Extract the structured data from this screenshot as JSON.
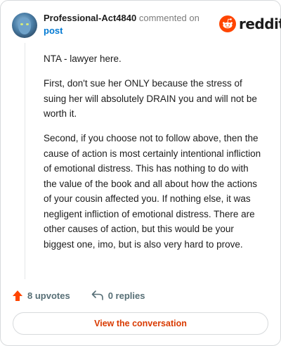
{
  "comment": {
    "username": "Professional-Act4840",
    "action_text": "commented on",
    "post_link_label": "post",
    "paragraphs": [
      "NTA - lawyer here.",
      "First, don't sue her ONLY because the stress of suing her will absolutely DRAIN you and will not be worth it.",
      "Second, if you choose not to follow above, then the cause of action is most certainly intentional infliction of emotional distress. This has nothing to do with the value of the book and all about how the actions of your cousin affected you. If nothing else, it was negligent infliction of emotional distress. There are other causes of action, but this would be your biggest one, imo, but is also very hard to prove."
    ]
  },
  "brand": {
    "name": "reddit",
    "icon": "reddit-snoo-icon",
    "color": "#ff4500"
  },
  "actions": {
    "upvotes_label": "8 upvotes",
    "upvote_icon": "upvote-arrow-icon",
    "upvote_color": "#ff4500",
    "replies_label": "0 replies",
    "reply_icon": "reply-arrow-icon"
  },
  "cta": {
    "label": "View the conversation",
    "color": "#d93a00"
  }
}
